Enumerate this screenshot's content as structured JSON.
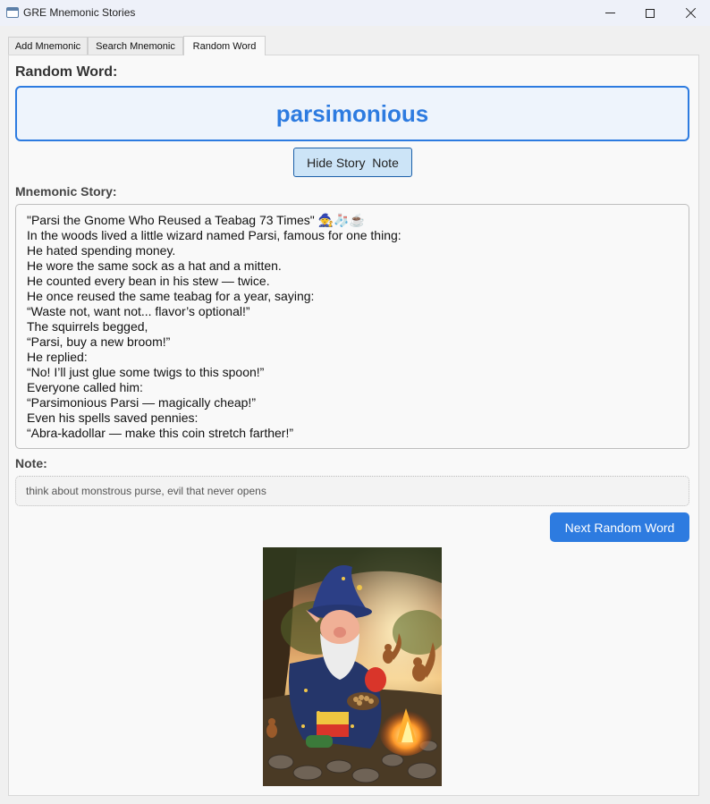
{
  "window": {
    "title": "GRE Mnemonic Stories"
  },
  "tabs": [
    {
      "label": "Add Mnemonic"
    },
    {
      "label": "Search Mnemonic"
    },
    {
      "label": "Random Word",
      "active": true
    }
  ],
  "random_word": {
    "label": "Random Word:",
    "word": "parsimonious"
  },
  "toggle_button": {
    "label": "Hide Story  Note"
  },
  "story": {
    "label": "Mnemonic Story:",
    "lines": [
      "\"Parsi the Gnome Who Reused a Teabag 73 Times\" 🧙🧦☕",
      "In the woods lived a little wizard named Parsi, famous for one thing:",
      "He hated spending money.",
      "He wore the same sock as a hat and a mitten.",
      "He counted every bean in his stew — twice.",
      "He once reused the same teabag for a year, saying:",
      "“Waste not, want not... flavor’s optional!”",
      "The squirrels begged,",
      "“Parsi, buy a new broom!”",
      "He replied:",
      "“No! I’ll just glue some twigs to this spoon!”",
      "Everyone called him:",
      "“Parsimonious Parsi — magically cheap!”",
      "Even his spells saved pennies:",
      "“Abra-kadollar — make this coin stretch farther!”"
    ]
  },
  "note": {
    "label": "Note:",
    "text": "think about monstrous purse, evil that never opens"
  },
  "next_button": {
    "label": "Next Random Word"
  },
  "colors": {
    "accent": "#2d7be0",
    "toggle_button_bg": "#cce4f7",
    "toggle_button_border": "#1b5fa8"
  }
}
